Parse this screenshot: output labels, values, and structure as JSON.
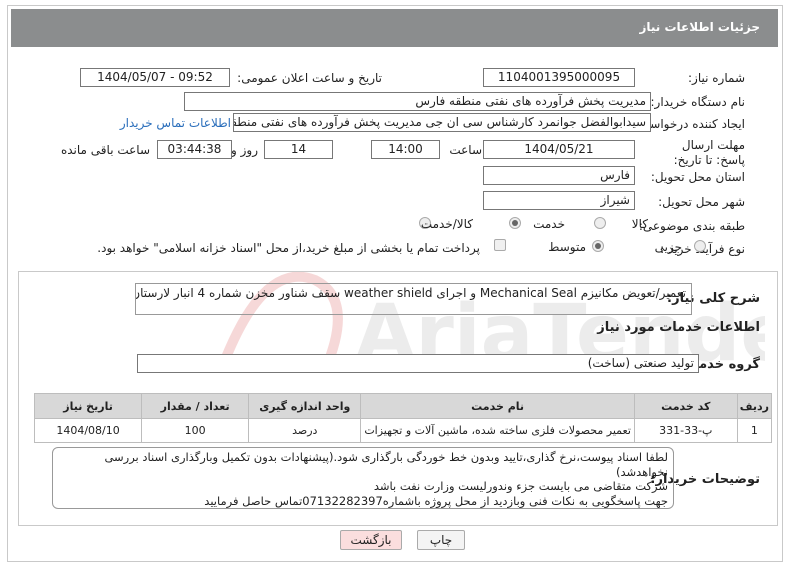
{
  "header": {
    "title": "جزئیات اطلاعات نیاز"
  },
  "labels": {
    "need_number": "شماره نیاز:",
    "announce_datetime": "تاریخ و ساعت اعلان عمومی:",
    "buyer_org": "نام دستگاه خریدار:",
    "requester": "ایجاد کننده درخواست:",
    "reply_deadline": "مهلت ارسال پاسخ: تا تاریخ:",
    "time_word": "ساعت",
    "day_word": "روز و",
    "remaining": "ساعت باقی مانده",
    "province": "استان محل تحویل:",
    "city": "شهر محل تحویل:",
    "category": "طبقه بندی موضوعی:",
    "process_type": "نوع فرآیند خرید :",
    "summary": "شرح کلی نیاز:",
    "services_info": "اطلاعات خدمات مورد نیاز",
    "service_group": "گروه خدمت:",
    "buyer_notes": "توضیحات خریدار:"
  },
  "fields": {
    "need_number": "1104001395000095",
    "announce_datetime": "1404/05/07 - 09:52",
    "buyer_org": "مدیریت پخش فرآورده های نفتی منطقه فارس",
    "requester": "سیدابوالفضل جوانمرد کارشناس سی ان جی مدیریت پخش فرآورده های نفتی منطقه فارس",
    "contact_link": "اطلاعات تماس خریدار",
    "reply_date": "1404/05/21",
    "reply_time": "14:00",
    "days": "14",
    "remaining_time": "03:44:38",
    "province": "فارس",
    "city": "شیراز",
    "summary": "تعمیر/تعویض مکانیزم Mechanical Seal  و اجرای weather shield سقف شناور مخزن شماره 4 انبار لارستان",
    "service_group": "تولید صنعتی (ساخت)"
  },
  "category_options": [
    {
      "label": "کالا",
      "selected": false
    },
    {
      "label": "خدمت",
      "selected": true
    },
    {
      "label": "کالا/خدمت",
      "selected": false
    }
  ],
  "process_options": [
    {
      "label": "جزیی",
      "selected": false
    },
    {
      "label": "متوسط",
      "selected": true
    }
  ],
  "payment_note": "پرداخت تمام یا بخشی از مبلغ خرید،از محل \"اسناد خزانه اسلامی\" خواهد بود.",
  "table": {
    "headers": [
      "ردیف",
      "کد خدمت",
      "نام خدمت",
      "واحد اندازه گیری",
      "تعداد / مقدار",
      "تاریخ نیاز"
    ],
    "rows": [
      [
        "1",
        "پ-33-331",
        "تعمیر محصولات فلزی ساخته شده، ماشین آلات و تجهیزات",
        "درصد",
        "100",
        "1404/08/10"
      ]
    ]
  },
  "notes_lines": [
    "لطفا اسناد پیوست،نرخ گذاری،تایید وبدون خط خوردگی بارگذاری شود.(پیشنهادات بدون تکمیل وبارگذاری اسناد بررسی نخواهدشد)",
    "شرکت متقاضی می بایست جزء وندورلیست وزارت نفت باشد",
    "جهت پاسخگویی به نکات فنی وبازدید از محل پروژه باشماره07132282397تماس حاصل فرمایید"
  ],
  "buttons": {
    "print": "چاپ",
    "back": "بازگشت"
  },
  "watermark": {
    "text": "AriaTender.neT"
  },
  "colors": {
    "header_bg": "#8b8d8e",
    "link": "#2a6ebb",
    "back_bg": "#fbdede",
    "table_header": "#d8d8d8"
  }
}
